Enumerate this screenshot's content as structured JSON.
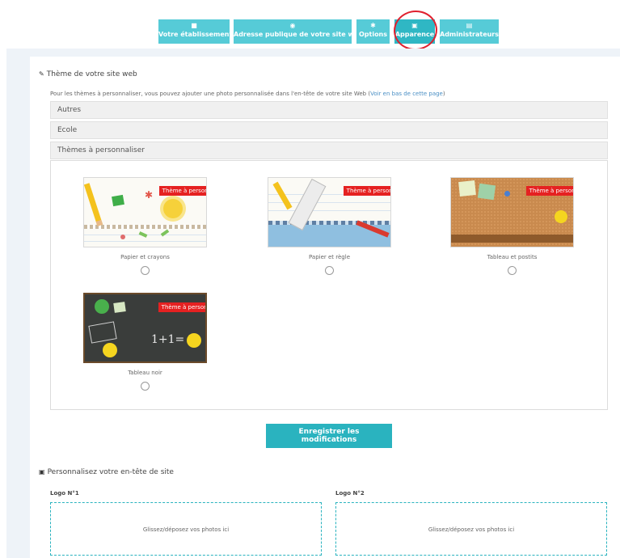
{
  "nav": [
    {
      "icon": "home",
      "label": "Votre établissement"
    },
    {
      "icon": "globe",
      "label": "Adresse publique de votre site web"
    },
    {
      "icon": "gear",
      "label": "Options"
    },
    {
      "icon": "image",
      "label": "Apparence"
    },
    {
      "icon": "user",
      "label": "Administrateurs"
    }
  ],
  "theme_section": {
    "title": "Thème de votre site web",
    "intro": "Pour les thèmes à personnaliser, vous pouvez ajouter une photo personnalisée dans l'en-tête de votre site Web (",
    "intro_link": "Voir en bas de cette page",
    "intro_end": ")"
  },
  "accordion": [
    "Autres",
    "Ecole",
    "Thèmes à personnaliser"
  ],
  "badge_label": "Thème à personnaliser",
  "themes": [
    {
      "name": "Papier et crayons"
    },
    {
      "name": "Papier et règle"
    },
    {
      "name": "Tableau et postits"
    },
    {
      "name": "Tableau noir"
    }
  ],
  "board_text": "1+1= 2",
  "save_button": "Enregistrer les modifications",
  "header_section": {
    "title": "Personnalisez votre en-tête de site"
  },
  "logos": [
    {
      "label": "Logo N°1",
      "drop": "Glissez/déposez vos photos ici"
    },
    {
      "label": "Logo N°2",
      "drop": "Glissez/déposez vos photos ici"
    }
  ],
  "colors": {
    "accent": "#2ab3bf",
    "nav": "#56cbd7",
    "badge": "#e52121",
    "annotation": "#e0202e"
  }
}
